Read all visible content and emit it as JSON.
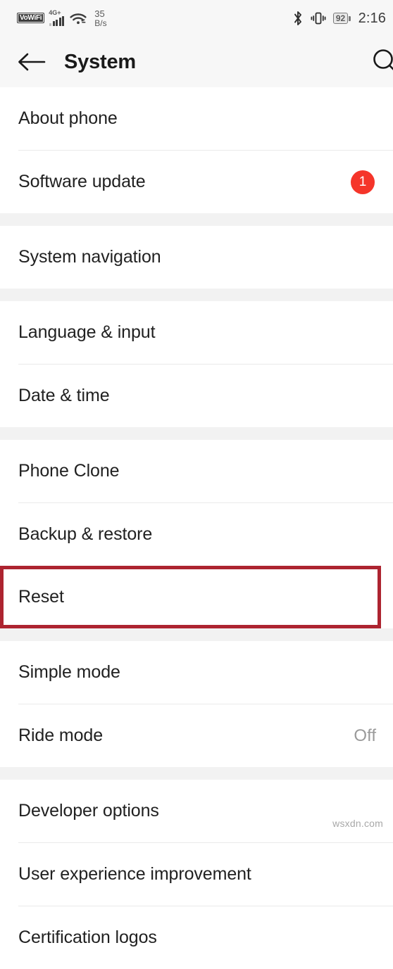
{
  "status_bar": {
    "vowifi_label": "VoWiFi",
    "network_type": "4G+",
    "signal_icon": "signal-bars-icon",
    "wifi_icon": "wifi-icon",
    "data_rate_value": "35",
    "data_rate_unit": "B/s",
    "bluetooth_icon": "bluetooth-icon",
    "vibrate_icon": "vibrate-icon",
    "battery_level": "92",
    "time": "2:16"
  },
  "app_bar": {
    "back_icon": "back-arrow-icon",
    "title": "System",
    "search_icon": "search-icon"
  },
  "sections": [
    {
      "rows": [
        {
          "label": "About phone",
          "value": "",
          "badge": "",
          "highlighted": false
        },
        {
          "label": "Software update",
          "value": "",
          "badge": "1",
          "highlighted": false
        }
      ]
    },
    {
      "rows": [
        {
          "label": "System navigation",
          "value": "",
          "badge": "",
          "highlighted": false
        }
      ]
    },
    {
      "rows": [
        {
          "label": "Language & input",
          "value": "",
          "badge": "",
          "highlighted": false
        },
        {
          "label": "Date & time",
          "value": "",
          "badge": "",
          "highlighted": false
        }
      ]
    },
    {
      "rows": [
        {
          "label": "Phone Clone",
          "value": "",
          "badge": "",
          "highlighted": false
        },
        {
          "label": "Backup & restore",
          "value": "",
          "badge": "",
          "highlighted": false
        },
        {
          "label": "Reset",
          "value": "",
          "badge": "",
          "highlighted": true
        }
      ]
    },
    {
      "rows": [
        {
          "label": "Simple mode",
          "value": "",
          "badge": "",
          "highlighted": false
        },
        {
          "label": "Ride mode",
          "value": "Off",
          "badge": "",
          "highlighted": false
        }
      ]
    },
    {
      "rows": [
        {
          "label": "Developer options",
          "value": "",
          "badge": "",
          "highlighted": false
        },
        {
          "label": "User experience improvement",
          "value": "",
          "badge": "",
          "highlighted": false
        },
        {
          "label": "Certification logos",
          "value": "",
          "badge": "",
          "highlighted": false
        }
      ]
    }
  ],
  "watermark": {
    "text": "wsxdn.com"
  },
  "colors": {
    "badge_red": "#f5352a",
    "highlight_red": "#ad2430",
    "section_gap": "#f2f2f2",
    "bar_background": "#f7f7f7"
  }
}
